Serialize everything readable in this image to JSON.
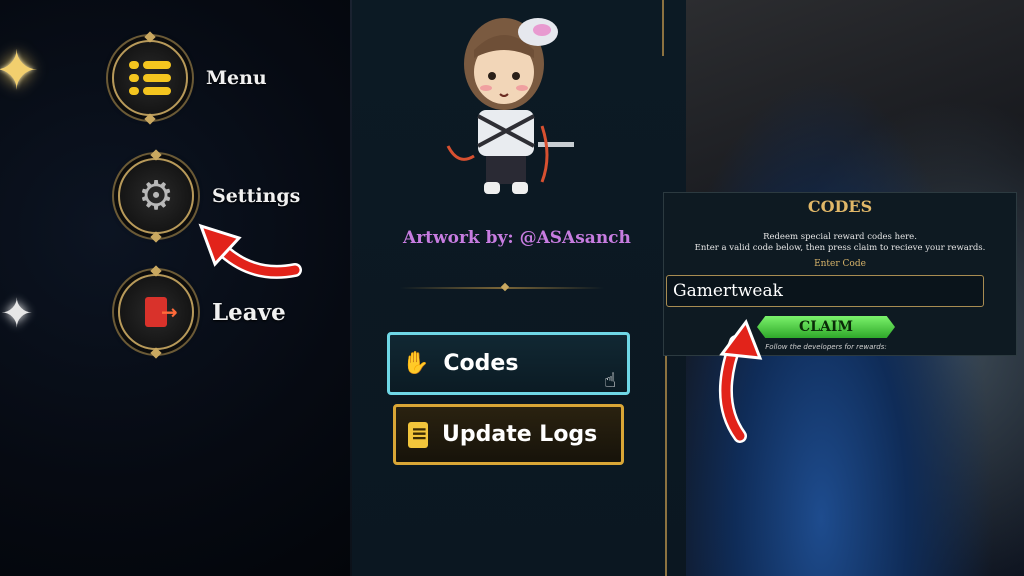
{
  "sidebar": {
    "items": [
      {
        "label": "Menu",
        "icon": "menu-icon"
      },
      {
        "label": "Settings",
        "icon": "gear-icon"
      },
      {
        "label": "Leave",
        "icon": "exit-door-icon"
      }
    ]
  },
  "center": {
    "credit": "Artwork by: @ASAsanch",
    "buttons": {
      "codes": "Codes",
      "update_logs": "Update Logs"
    }
  },
  "codes_panel": {
    "title": "CODES",
    "desc_line1": "Redeem special reward codes here.",
    "desc_line2": "Enter a valid code below, then press claim to recieve your rewards.",
    "enter_label": "Enter Code",
    "input_value": "Gamertweak",
    "claim_label": "CLAIM",
    "follow_text": "Follow the developers for rewards:"
  },
  "colors": {
    "accent_gold": "#c9a860",
    "codes_border": "#6fd7e6",
    "logs_border": "#d9a636",
    "claim_green": "#4ccc3f",
    "arrow_red": "#e2231a"
  }
}
